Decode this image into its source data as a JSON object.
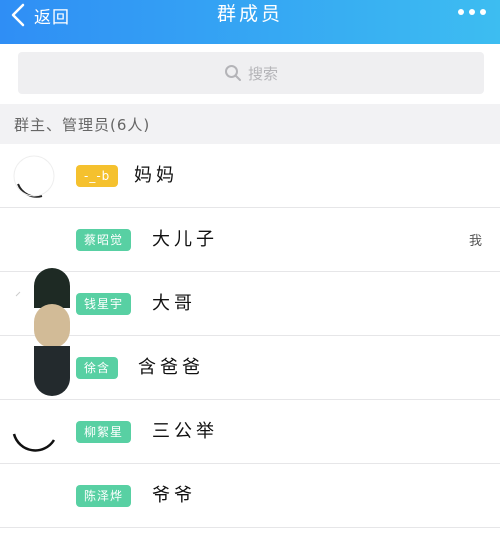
{
  "header": {
    "back_label": "返回",
    "title": "群成员",
    "more_icon": "more-dots-icon",
    "gradient_start": "#2f8ef5",
    "gradient_end": "#3dbdf1"
  },
  "search": {
    "placeholder": "搜索",
    "icon": "search-icon"
  },
  "section": {
    "label": "群主、管理员(6人)"
  },
  "members": [
    {
      "badge": "-_-b",
      "badge_color": "#f5c12e",
      "name": "妈妈",
      "me": ""
    },
    {
      "badge": "蔡昭觉",
      "badge_color": "#58d0a3",
      "name": "大儿子",
      "me": "我"
    },
    {
      "badge": "钱星宇",
      "badge_color": "#58d0a3",
      "name": "大哥",
      "me": ""
    },
    {
      "badge": "徐含",
      "badge_color": "#58d0a3",
      "name": "含爸爸",
      "me": ""
    },
    {
      "badge": "柳絮星",
      "badge_color": "#58d0a3",
      "name": "三公举",
      "me": ""
    },
    {
      "badge": "陈泽烨",
      "badge_color": "#58d0a3",
      "name": "爷爷",
      "me": ""
    }
  ]
}
